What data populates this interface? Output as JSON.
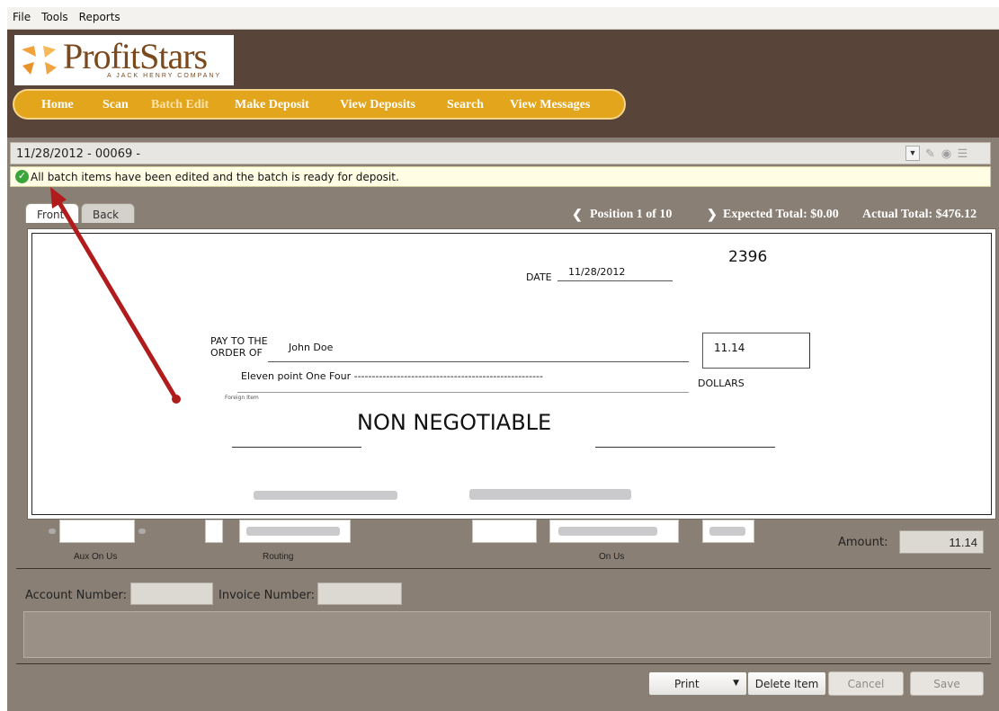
{
  "menu": {
    "items": [
      "File",
      "Tools",
      "Reports"
    ]
  },
  "logo": {
    "brand": "ProfitStars",
    "tagline": "A JACK HENRY COMPANY"
  },
  "nav": {
    "items": [
      "Home",
      "Scan",
      "Batch Edit",
      "Make Deposit",
      "View Deposits",
      "Search",
      "View Messages"
    ],
    "active": "Batch Edit"
  },
  "batch": {
    "selected": "11/28/2012 - 00069 -"
  },
  "notice": {
    "text": "All batch items have been edited and the batch is ready for deposit."
  },
  "tabs": {
    "front": "Front",
    "back": "Back"
  },
  "position": {
    "prev_glyph": "❮",
    "label": "Position 1 of 10",
    "next_glyph": "❯",
    "expected": "Expected Total: $0.00",
    "actual": "Actual Total: $476.12"
  },
  "check": {
    "number": "2396",
    "date_label": "DATE",
    "date": "11/28/2012",
    "pay_to_line1": "PAY TO THE",
    "pay_to_line2": "ORDER OF",
    "payee": "John Doe",
    "amount_box": "11.14",
    "written_amount": "Eleven point One Four -----------------------------------------------------",
    "dollars": "DOLLARS",
    "memo": "Foreign Item",
    "stamp": "NON NEGOTIABLE"
  },
  "micr": {
    "aux_on_us_label": "Aux On Us",
    "routing_label": "Routing",
    "on_us_label": "On Us"
  },
  "amount": {
    "label": "Amount:",
    "value": "11.14"
  },
  "fields": {
    "account_label": "Account Number:",
    "invoice_label": "Invoice Number:"
  },
  "buttons": {
    "print": "Print",
    "delete": "Delete Item",
    "cancel": "Cancel",
    "save": "Save"
  },
  "colors": {
    "header": "#584438",
    "nav": "#e3a51c",
    "frame": "#8a7f74",
    "notice_bg": "#fffde3",
    "arrow": "#b01c1c"
  }
}
